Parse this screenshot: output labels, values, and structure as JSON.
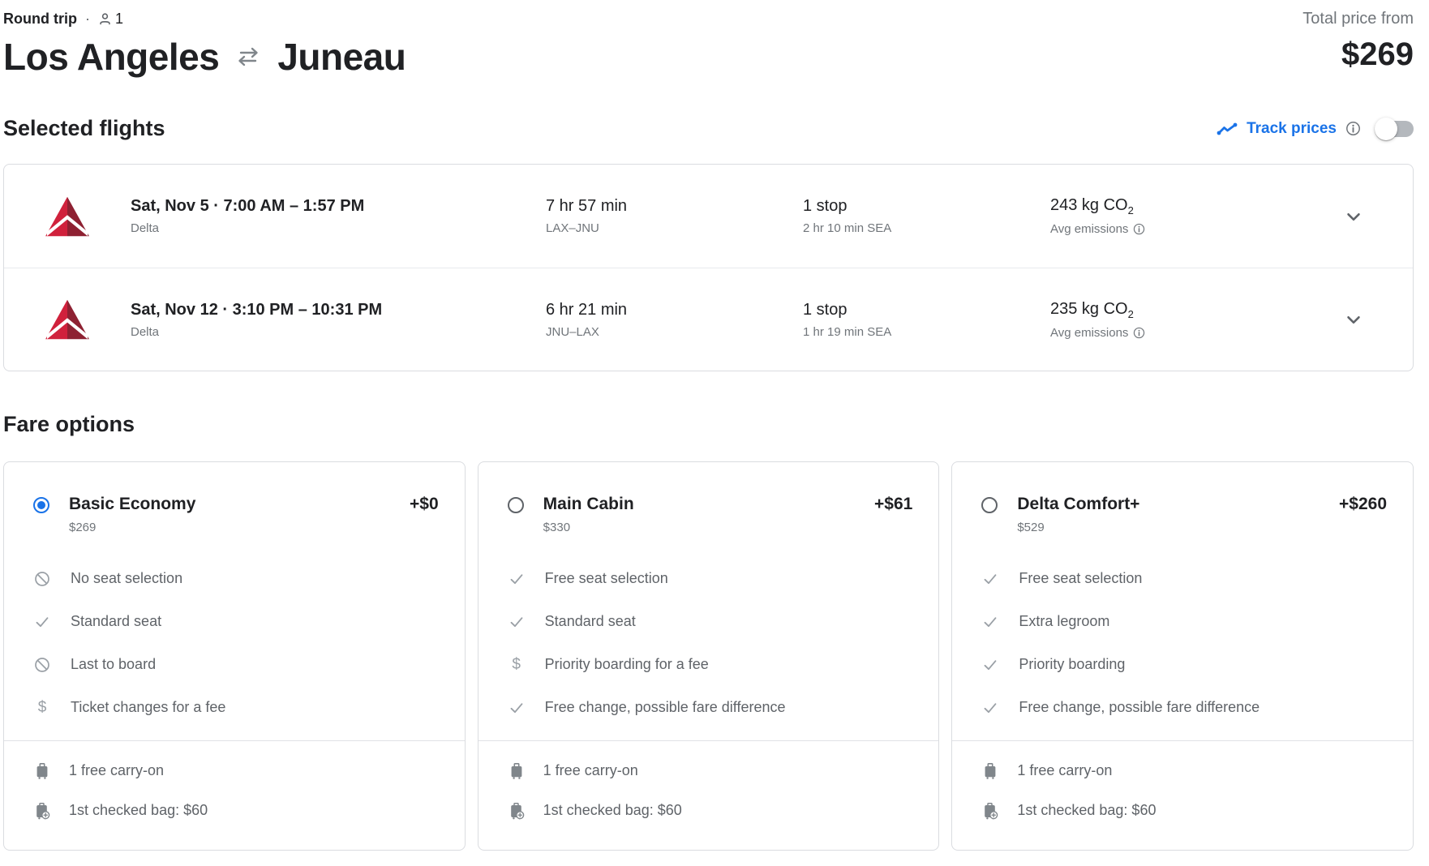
{
  "header": {
    "trip_type": "Round trip",
    "separator": "·",
    "passenger_count": "1",
    "origin": "Los Angeles",
    "destination": "Juneau",
    "total_price_label": "Total price from",
    "total_price": "$269"
  },
  "selected_flights": {
    "heading": "Selected flights",
    "track_prices": {
      "label": "Track prices",
      "enabled": false
    },
    "flights": [
      {
        "airline": "Delta",
        "date_time": "Sat, Nov 5 · 7:00 AM – 1:57 PM",
        "duration": "7 hr 57 min",
        "route": "LAX–JNU",
        "stops": "1 stop",
        "stop_detail": "2 hr 10 min SEA",
        "emissions": "243 kg CO",
        "emissions_sub": "2",
        "emissions_note": "Avg emissions"
      },
      {
        "airline": "Delta",
        "date_time": "Sat, Nov 12 · 3:10 PM – 10:31 PM",
        "duration": "6 hr 21 min",
        "route": "JNU–LAX",
        "stops": "1 stop",
        "stop_detail": "1 hr 19 min SEA",
        "emissions": "235 kg CO",
        "emissions_sub": "2",
        "emissions_note": "Avg emissions"
      }
    ]
  },
  "fare_options": {
    "heading": "Fare options",
    "cards": [
      {
        "name": "Basic Economy",
        "price": "$269",
        "price_delta": "+$0",
        "selected": true,
        "features": [
          {
            "icon": "no",
            "label": "No seat selection"
          },
          {
            "icon": "check",
            "label": "Standard seat"
          },
          {
            "icon": "no",
            "label": "Last to board"
          },
          {
            "icon": "dollar",
            "label": "Ticket changes for a fee"
          }
        ],
        "baggage": [
          {
            "icon": "carry-on-bag",
            "label": "1 free carry-on"
          },
          {
            "icon": "checked-bag-add",
            "label": "1st checked bag: $60"
          }
        ]
      },
      {
        "name": "Main Cabin",
        "price": "$330",
        "price_delta": "+$61",
        "selected": false,
        "features": [
          {
            "icon": "check",
            "label": "Free seat selection"
          },
          {
            "icon": "check",
            "label": "Standard seat"
          },
          {
            "icon": "dollar",
            "label": "Priority boarding for a fee"
          },
          {
            "icon": "check",
            "label": "Free change, possible fare difference"
          }
        ],
        "baggage": [
          {
            "icon": "carry-on-bag",
            "label": "1 free carry-on"
          },
          {
            "icon": "checked-bag-add",
            "label": "1st checked bag: $60"
          }
        ]
      },
      {
        "name": "Delta Comfort+",
        "price": "$529",
        "price_delta": "+$260",
        "selected": false,
        "features": [
          {
            "icon": "check",
            "label": "Free seat selection"
          },
          {
            "icon": "check",
            "label": "Extra legroom"
          },
          {
            "icon": "check",
            "label": "Priority boarding"
          },
          {
            "icon": "check",
            "label": "Free change, possible fare difference"
          }
        ],
        "baggage": [
          {
            "icon": "carry-on-bag",
            "label": "1 free carry-on"
          },
          {
            "icon": "checked-bag-add",
            "label": "1st checked bag: $60"
          }
        ]
      }
    ]
  },
  "icons": {
    "dollar_glyph": "$"
  },
  "colors": {
    "accent_blue": "#1a73e8",
    "delta_logo_light": "#d0213c",
    "delta_logo_dark": "#8e2132"
  }
}
